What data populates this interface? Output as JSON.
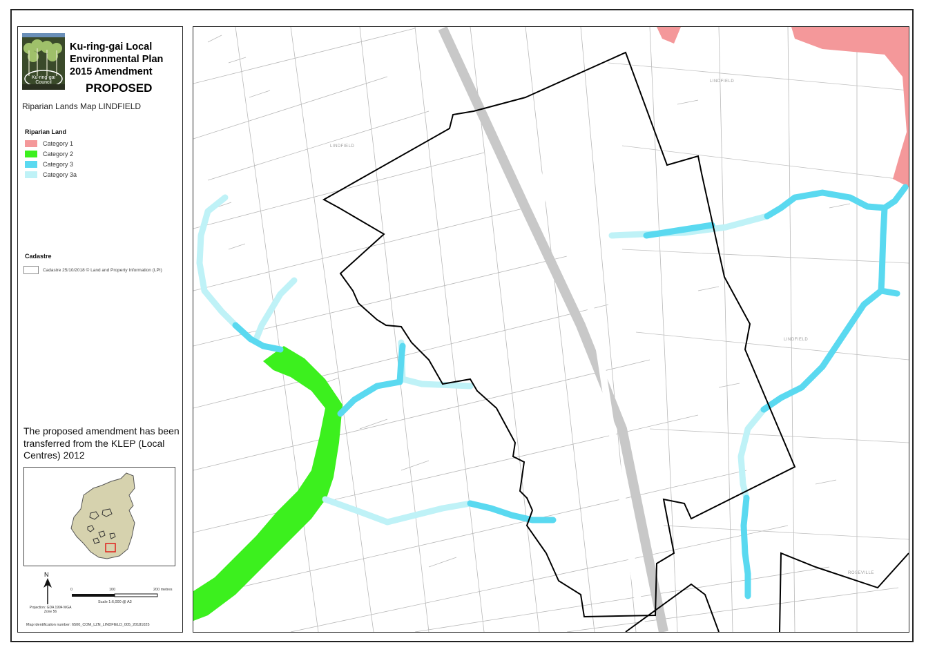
{
  "title": {
    "line1": "Ku-ring-gai Local",
    "line2": "Environmental Plan",
    "line3": "2015 Amendment",
    "status": "PROPOSED"
  },
  "logo_text": {
    "line1": "Ku-ring-gai",
    "line2": "Council"
  },
  "map_name": "Riparian Lands Map LINDFIELD",
  "riparian": {
    "heading": "Riparian Land",
    "items": [
      {
        "label": "Category 1",
        "color": "#f4989a"
      },
      {
        "label": "Category 2",
        "color": "#3cf01e"
      },
      {
        "label": "Category 3",
        "color": "#5ad9f0"
      },
      {
        "label": "Category 3a",
        "color": "#bff2f7"
      }
    ]
  },
  "cadastre": {
    "heading": "Cadastre",
    "item": "Cadastre 25/10/2018 © Land and Property Information (LPI)"
  },
  "note": "The proposed amendment has been transferred from the KLEP (Local Centres) 2012",
  "north_label": "N",
  "projection": "Projection: GDA 1994 MGA Zone 56",
  "scale": {
    "ticks": [
      "0",
      "100",
      "200 metres"
    ],
    "text": "Scale 1:6,000 @ A3"
  },
  "map_id": "Map identification number: 6500_COM_LZN_LINDFIELD_005_20181025",
  "street_labels": [
    "LINDFIELD",
    "LINDFIELD",
    "LINDFIELD",
    "ROSEVILLE"
  ]
}
